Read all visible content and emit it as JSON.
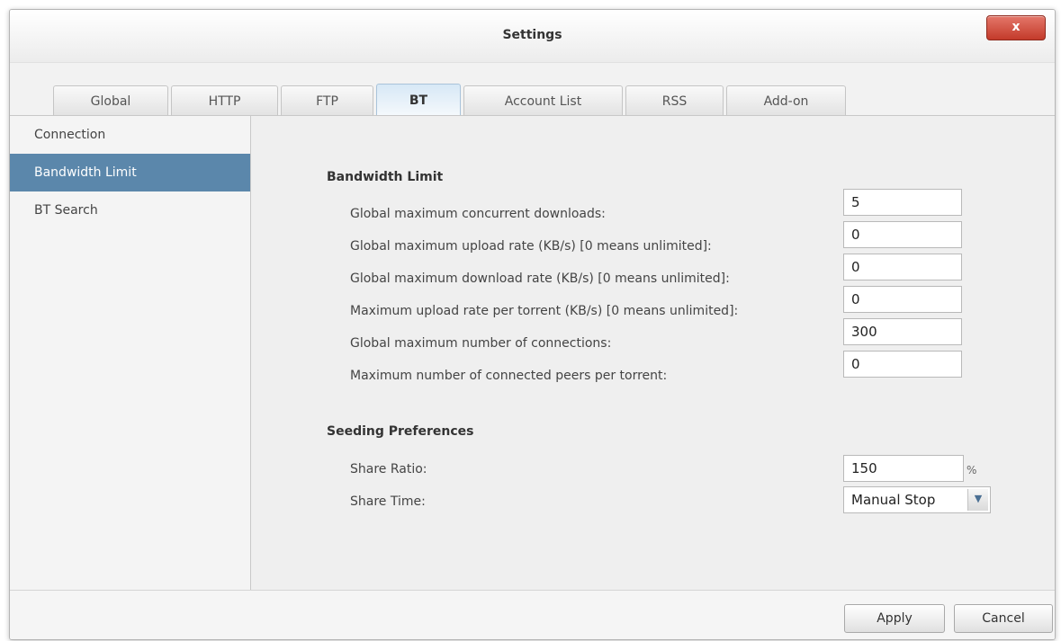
{
  "window": {
    "title": "Settings",
    "close_label": "x"
  },
  "tabs": [
    {
      "label": "Global",
      "active": false
    },
    {
      "label": "HTTP",
      "active": false
    },
    {
      "label": "FTP",
      "active": false
    },
    {
      "label": "BT",
      "active": true
    },
    {
      "label": "Account List",
      "active": false
    },
    {
      "label": "RSS",
      "active": false
    },
    {
      "label": "Add-on",
      "active": false
    }
  ],
  "sidebar": {
    "items": [
      {
        "label": "Connection",
        "active": false
      },
      {
        "label": "Bandwidth Limit",
        "active": true
      },
      {
        "label": "BT Search",
        "active": false
      }
    ]
  },
  "bandwidth": {
    "heading": "Bandwidth Limit",
    "rows": [
      {
        "label": "Global maximum concurrent downloads:",
        "value": "5"
      },
      {
        "label": "Global maximum upload rate (KB/s) [0 means unlimited]:",
        "value": "0"
      },
      {
        "label": "Global maximum download rate (KB/s) [0 means unlimited]:",
        "value": "0"
      },
      {
        "label": "Maximum upload rate per torrent (KB/s) [0 means unlimited]:",
        "value": "0"
      },
      {
        "label": "Global maximum number of connections:",
        "value": "300"
      },
      {
        "label": "Maximum number of connected peers per torrent:",
        "value": "0"
      }
    ]
  },
  "seeding": {
    "heading": "Seeding Preferences",
    "share_ratio_label": "Share Ratio:",
    "share_ratio_value": "150",
    "share_ratio_unit": "%",
    "share_time_label": "Share Time:",
    "share_time_value": "Manual Stop"
  },
  "footer": {
    "apply_label": "Apply",
    "cancel_label": "Cancel"
  },
  "colors": {
    "accent": "#5b87ab",
    "close_button": "#c33a2a"
  }
}
